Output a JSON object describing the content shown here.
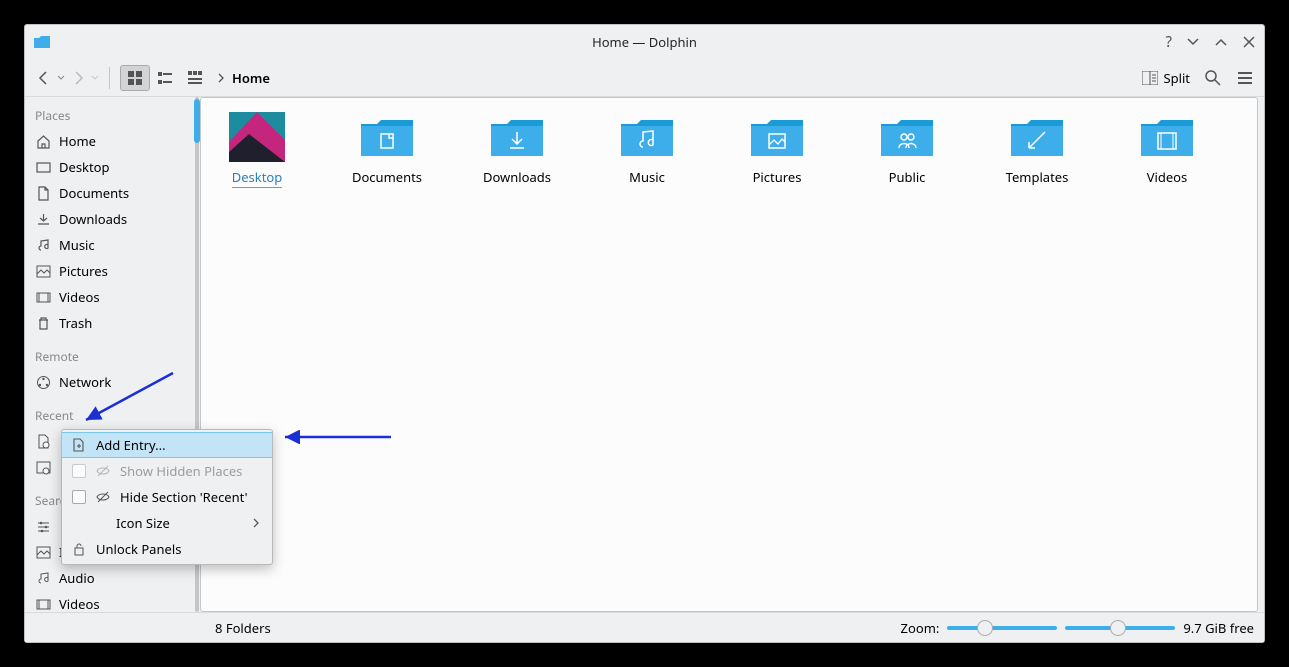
{
  "window": {
    "title": "Home — Dolphin"
  },
  "toolbar": {
    "split_label": "Split"
  },
  "breadcrumb": {
    "items": [
      "Home"
    ]
  },
  "sidebar": {
    "sections": {
      "places": {
        "header": "Places",
        "items": [
          "Home",
          "Desktop",
          "Documents",
          "Downloads",
          "Music",
          "Pictures",
          "Videos",
          "Trash"
        ]
      },
      "remote": {
        "header": "Remote",
        "items": [
          "Network"
        ]
      },
      "recent": {
        "header": "Recent"
      },
      "search": {
        "header": "Searc",
        "items": [
          "Images",
          "Audio",
          "Videos"
        ]
      }
    }
  },
  "folders": [
    "Desktop",
    "Documents",
    "Downloads",
    "Music",
    "Pictures",
    "Public",
    "Templates",
    "Videos"
  ],
  "statusbar": {
    "count": "8 Folders",
    "zoom_label": "Zoom:",
    "free": "9.7 GiB free"
  },
  "context_menu": {
    "items": [
      {
        "label": "Add Entry...",
        "highlight": true,
        "icon": "plus-file"
      },
      {
        "label": "Show Hidden Places",
        "disabled": true,
        "checkbox": true,
        "icon": "eye"
      },
      {
        "label": "Hide Section 'Recent'",
        "checkbox": true,
        "icon": "eye"
      },
      {
        "label": "Icon Size",
        "submenu": true
      },
      {
        "label": "Unlock Panels",
        "icon": "lock"
      }
    ]
  }
}
